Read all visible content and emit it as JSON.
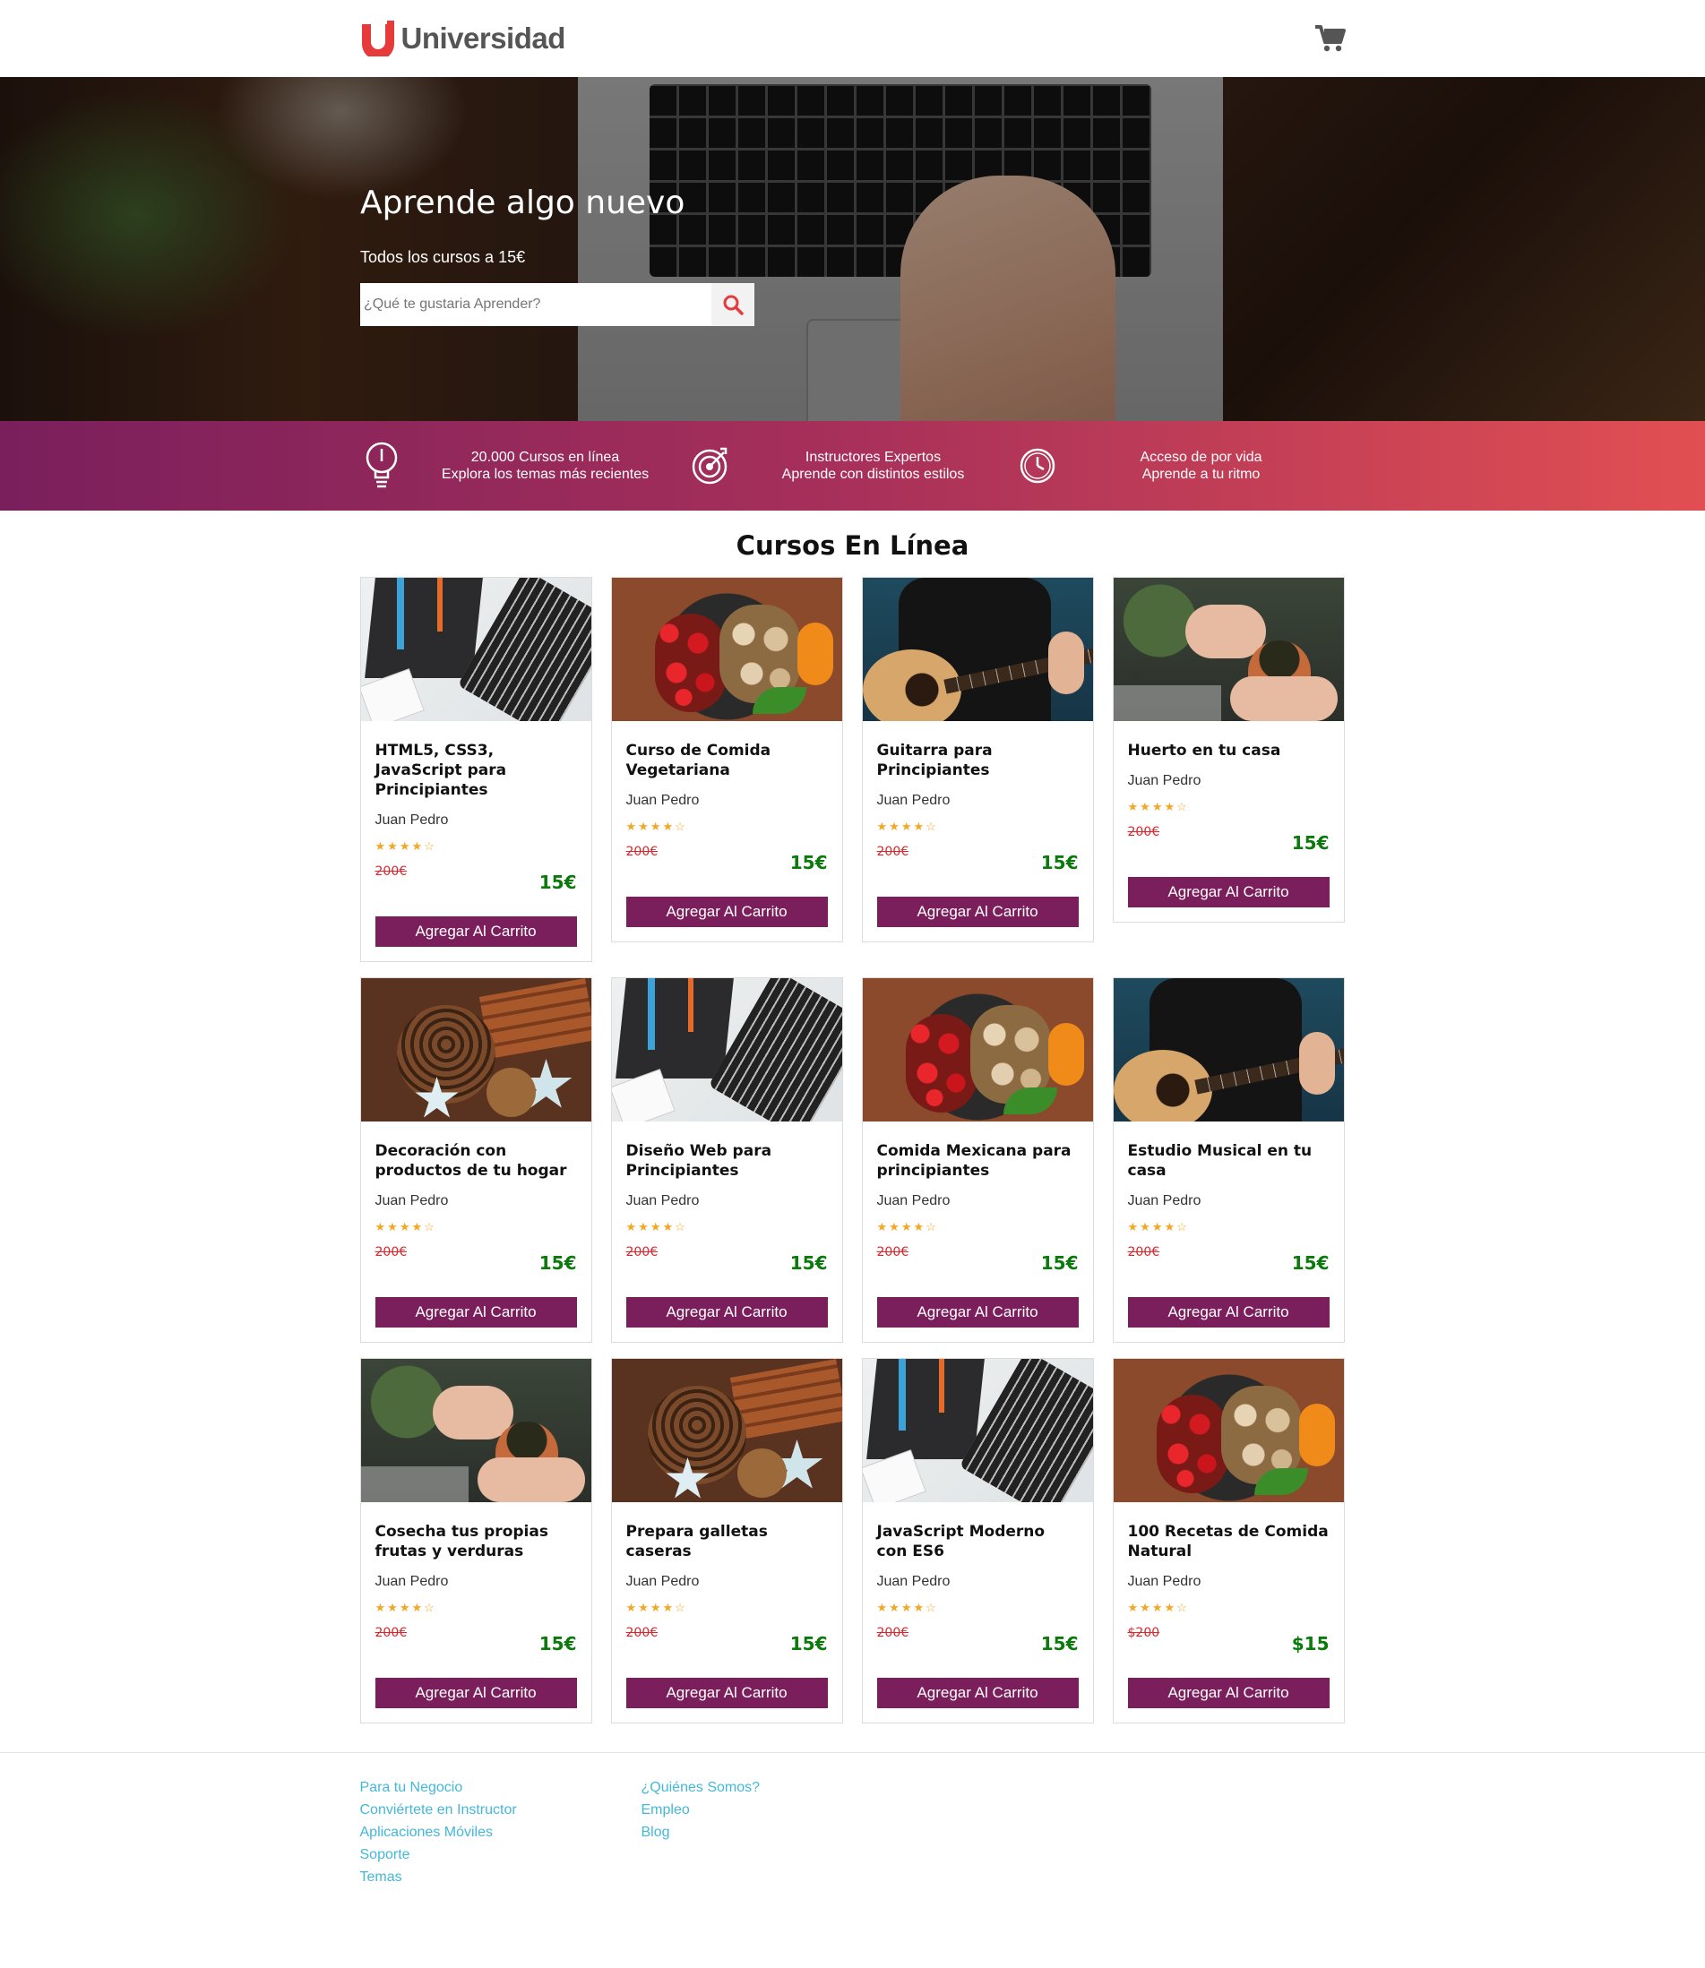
{
  "header": {
    "logo_text": "Universidad",
    "logo_color": "#e73a3a",
    "cart_icon": "cart-icon"
  },
  "hero": {
    "title": "Aprende algo nuevo",
    "subtitle": "Todos los cursos a 15€",
    "search_placeholder": "¿Qué te gustaria Aprender?",
    "search_icon": "search-icon"
  },
  "features": [
    {
      "icon": "lightbulb-icon",
      "line1": "20.000 Cursos en línea",
      "line2": "Explora los temas más recientes"
    },
    {
      "icon": "target-icon",
      "line1": "Instructores Expertos",
      "line2": "Aprende con distintos estilos"
    },
    {
      "icon": "clock-icon",
      "line1": "Acceso de por vida",
      "line2": "Aprende a tu ritmo"
    }
  ],
  "courses_title": "Cursos En Línea",
  "add_label": "Agregar Al Carrito",
  "courses": [
    {
      "title": "HTML5, CSS3, JavaScript para Principiantes",
      "author": "Juan Pedro",
      "rating": 4.5,
      "old_price": "200€",
      "price": "15€",
      "image": "html"
    },
    {
      "title": "Curso de Comida Vegetariana",
      "author": "Juan Pedro",
      "rating": 4.5,
      "old_price": "200€",
      "price": "15€",
      "image": "food"
    },
    {
      "title": "Guitarra para Principiantes",
      "author": "Juan Pedro",
      "rating": 4.5,
      "old_price": "200€",
      "price": "15€",
      "image": "guitar"
    },
    {
      "title": "Huerto en tu casa",
      "author": "Juan Pedro",
      "rating": 4.5,
      "old_price": "200€",
      "price": "15€",
      "image": "garden"
    },
    {
      "title": "Decoración con productos de tu hogar",
      "author": "Juan Pedro",
      "rating": 4.5,
      "old_price": "200€",
      "price": "15€",
      "image": "xmas"
    },
    {
      "title": "Diseño Web para Principiantes",
      "author": "Juan Pedro",
      "rating": 4.5,
      "old_price": "200€",
      "price": "15€",
      "image": "html"
    },
    {
      "title": "Comida Mexicana para principiantes",
      "author": "Juan Pedro",
      "rating": 4.5,
      "old_price": "200€",
      "price": "15€",
      "image": "food"
    },
    {
      "title": "Estudio Musical en tu casa",
      "author": "Juan Pedro",
      "rating": 4.5,
      "old_price": "200€",
      "price": "15€",
      "image": "guitar"
    },
    {
      "title": "Cosecha tus propias frutas y verduras",
      "author": "Juan Pedro",
      "rating": 4.5,
      "old_price": "200€",
      "price": "15€",
      "image": "garden"
    },
    {
      "title": "Prepara galletas caseras",
      "author": "Juan Pedro",
      "rating": 4.5,
      "old_price": "200€",
      "price": "15€",
      "image": "xmas"
    },
    {
      "title": "JavaScript Moderno con ES6",
      "author": "Juan Pedro",
      "rating": 4.5,
      "old_price": "200€",
      "price": "15€",
      "image": "html"
    },
    {
      "title": "100 Recetas de Comida Natural",
      "author": "Juan Pedro",
      "rating": 4.5,
      "old_price": "$200",
      "price": "$15",
      "image": "food"
    }
  ],
  "footer": {
    "col1": [
      "Para tu Negocio",
      "Conviértete en Instructor",
      "Aplicaciones Móviles",
      "Soporte",
      "Temas"
    ],
    "col2": [
      "¿Quiénes Somos?",
      "Empleo",
      "Blog"
    ]
  },
  "colors": {
    "brand_purple": "#7a1f5c",
    "gradient_end": "#e14f52",
    "price_green": "#0a7a0a",
    "old_price_red": "#d9272e",
    "link_blue": "#43b8da"
  }
}
